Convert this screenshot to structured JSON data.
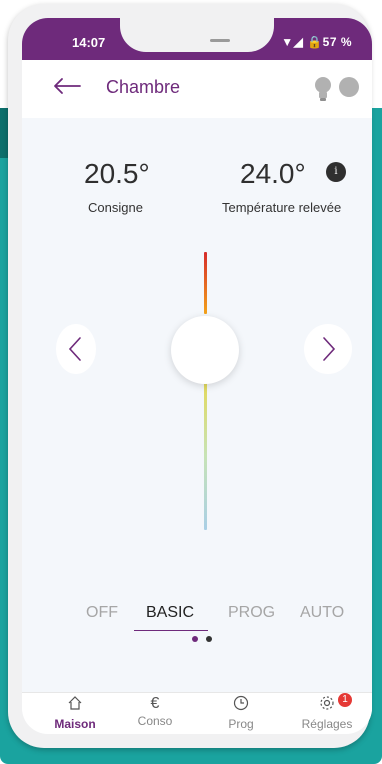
{
  "status": {
    "time": "14:07",
    "system": "▼◢ 🔒57 %"
  },
  "header": {
    "title": "Chambre"
  },
  "setpoint": {
    "value": "20.5",
    "unit": "°",
    "label": "Consigne"
  },
  "measured": {
    "value": "24.0",
    "unit": "°",
    "label": "Température relevée",
    "info": "i"
  },
  "modes": [
    {
      "label": "OFF",
      "active": false
    },
    {
      "label": "BASIC",
      "active": true
    },
    {
      "label": "PROG",
      "active": false
    },
    {
      "label": "AUTO",
      "active": false
    }
  ],
  "bottom_nav": {
    "items": [
      {
        "label": "Maison",
        "icon": "home-icon"
      },
      {
        "label": "Conso",
        "icon": "euro-icon"
      },
      {
        "label": "Prog",
        "icon": "clock-icon"
      },
      {
        "label": "Réglages",
        "icon": "settings-icon",
        "badge": "1"
      }
    ]
  },
  "colors": {
    "primary": "#6e2a7b",
    "teal": "#1aa39f",
    "badge": "#e53935"
  }
}
